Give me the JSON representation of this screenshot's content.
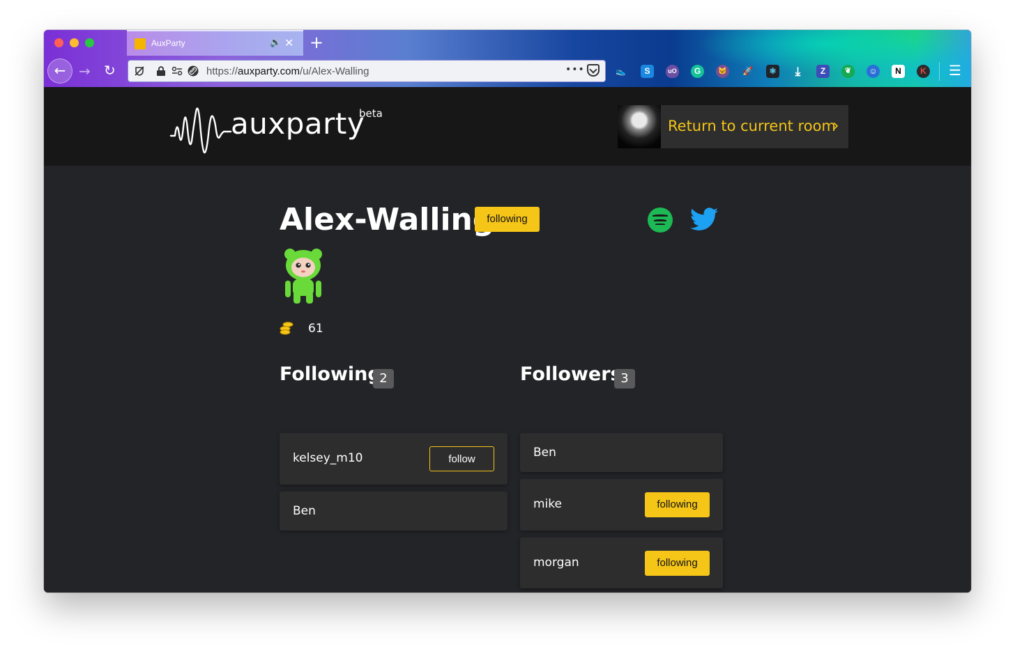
{
  "browser": {
    "tab_title": "AuxParty",
    "tab_audio_icon": "speaker-icon",
    "url_scheme": "https://",
    "url_host": "auxparty.com",
    "url_path": "/u/Alex-Walling",
    "url_more": "•••"
  },
  "header": {
    "logo_text": "auxparty",
    "logo_beta": "beta",
    "room_button_label": "Return to current room"
  },
  "profile": {
    "name": "Alex-Walling",
    "status_badge": "following",
    "coins": "61"
  },
  "following": {
    "title": "Following",
    "count": "2",
    "items": [
      {
        "name": "kelsey_m10",
        "action": "follow"
      },
      {
        "name": "Ben"
      }
    ]
  },
  "followers": {
    "title": "Followers",
    "count": "3",
    "items": [
      {
        "name": "Ben"
      },
      {
        "name": "mike",
        "action": "following"
      },
      {
        "name": "morgan",
        "action": "following"
      }
    ]
  },
  "colors": {
    "accent": "#f5c518",
    "page_bg": "#232428",
    "header_bg": "#171717",
    "card_bg": "#2d2d2e",
    "spotify": "#1db954",
    "twitter": "#1da1f2",
    "avatar": "#6ad93a"
  }
}
